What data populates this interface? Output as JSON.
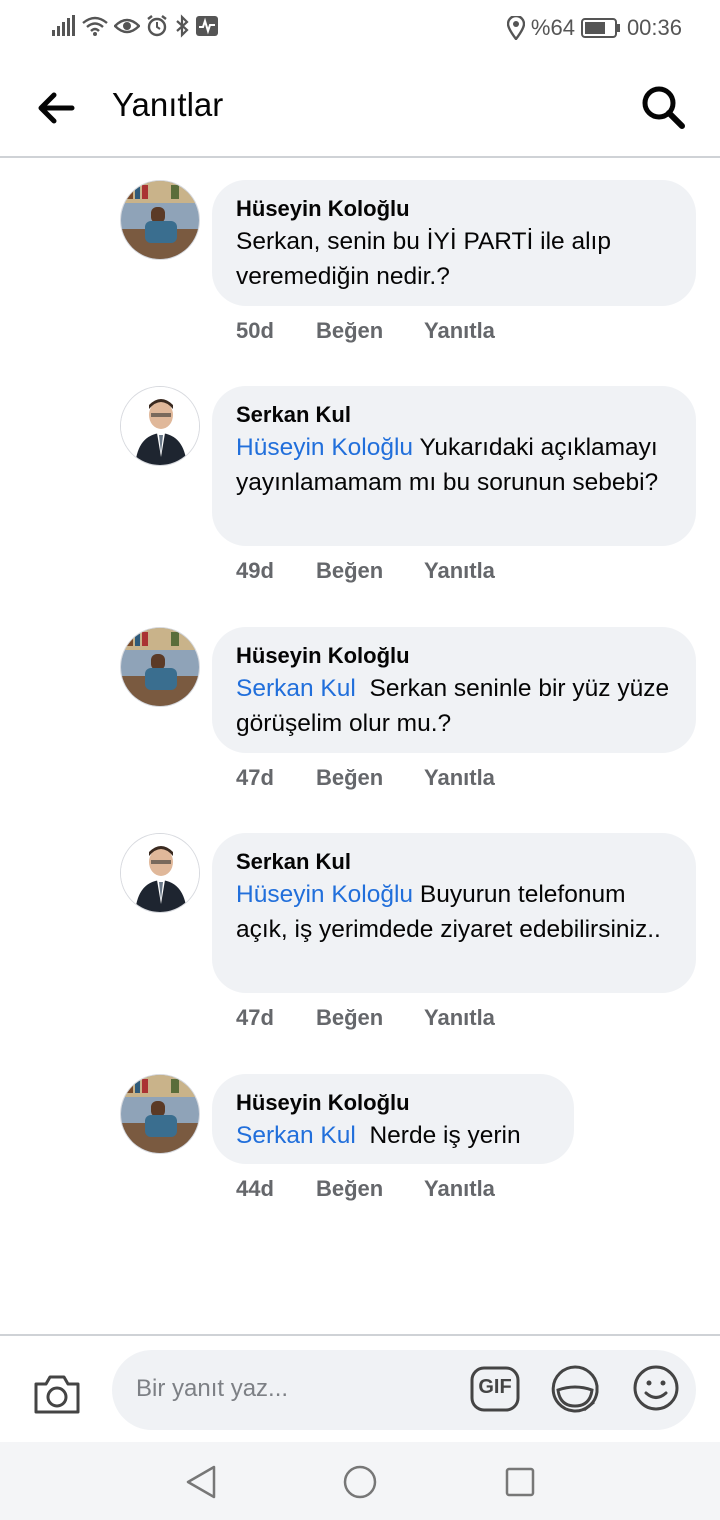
{
  "status_bar": {
    "battery": "%64",
    "time": "00:36"
  },
  "header": {
    "title": "Yanıtlar"
  },
  "comments": [
    {
      "author": "Hüseyin Koloğlu",
      "mention": "",
      "text": "Serkan, senin bu İYİ PARTİ ile alıp veremediğin nedir.?",
      "time": "50d",
      "like_label": "Beğen",
      "reply_label": "Yanıtla"
    },
    {
      "author": "Serkan Kul",
      "mention": "Hüseyin Koloğlu",
      "text": "Yukarıdaki açıklamayı yayınlamamam mı bu sorunun sebebi?",
      "time": "49d",
      "like_label": "Beğen",
      "reply_label": "Yanıtla"
    },
    {
      "author": "Hüseyin Koloğlu",
      "mention": "Serkan Kul",
      "text": "Serkan seninle bir yüz yüze görüşelim olur mu.?",
      "time": "47d",
      "like_label": "Beğen",
      "reply_label": "Yanıtla"
    },
    {
      "author": "Serkan Kul",
      "mention": "Hüseyin Koloğlu",
      "text": "Buyurun telefonum açık, iş yerimdede ziyaret edebilirsiniz..",
      "time": "47d",
      "like_label": "Beğen",
      "reply_label": "Yanıtla"
    },
    {
      "author": "Hüseyin Koloğlu",
      "mention": "Serkan Kul",
      "text": "Nerde iş yerin",
      "time": "44d",
      "like_label": "Beğen",
      "reply_label": "Yanıtla"
    }
  ],
  "composer": {
    "placeholder": "Bir yanıt yaz...",
    "gif_label": "GIF"
  },
  "colors": {
    "mention": "#216fdb",
    "bubble": "#f0f2f5",
    "meta": "#65676b"
  }
}
